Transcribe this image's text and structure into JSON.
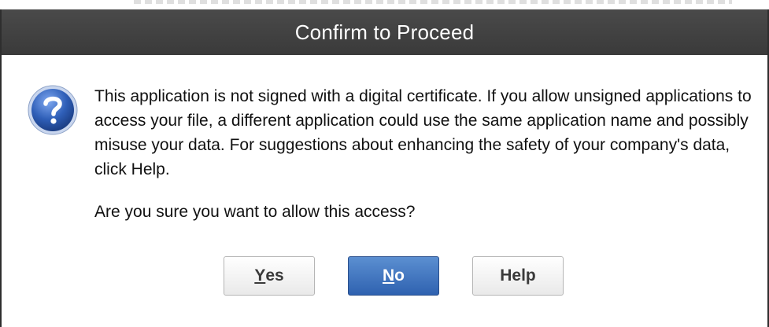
{
  "dialog": {
    "title": "Confirm to Proceed",
    "message": "This application is not signed with a digital certificate.  If you allow unsigned applications to access your file, a different application could use the same application name and possibly misuse your data.  For suggestions about enhancing the safety of your company's data, click Help.",
    "question": "Are you sure you want to allow this access?",
    "icon": "question-icon",
    "buttons": {
      "yes": {
        "key": "Y",
        "rest": "es"
      },
      "no": {
        "key": "N",
        "rest": "o"
      },
      "help": {
        "label": "Help"
      }
    }
  },
  "colors": {
    "titlebar": "#3f3f3f",
    "primary_button": "#3a6fbf"
  }
}
